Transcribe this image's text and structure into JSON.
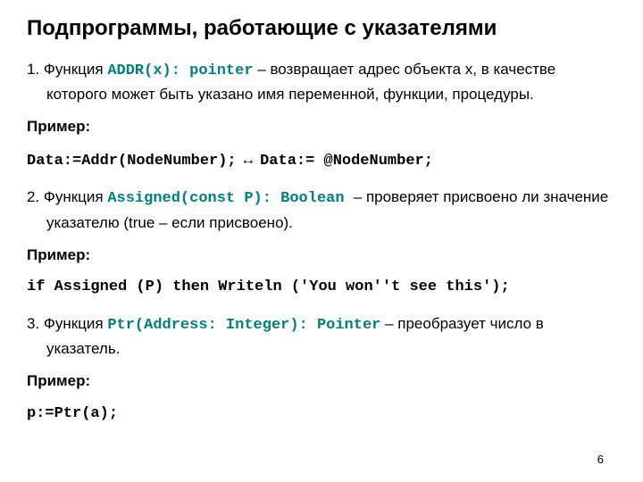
{
  "title": "Подпрограммы, работающие с указателями",
  "item1": {
    "lead": "1. Функция ",
    "code": "ADDR(x): pointer",
    "rest1": " – возвращает адрес объекта х, в качестве которого может быть указано имя переменной, функции, процедуры.",
    "exlabel": "Пример:",
    "exline_a": "Data:=Addr(NodeNumber);",
    "exline_arrow": " ↔ ",
    "exline_b": "Data:= @NodeNumber;"
  },
  "item2": {
    "lead": "2. Функция ",
    "code": "Assigned(const P): Boolean ",
    "rest1": " – проверяет присвоено ли значение указателю (true – если присвоено).",
    "exlabel": "Пример:",
    "exline": "if Assigned (P) then Writeln ('You won''t see this');"
  },
  "item3": {
    "lead": "3. Функция ",
    "code": "Ptr(Address: Integer): Pointer",
    "rest1": " – преобразует число в указатель.",
    "exlabel": "Пример:",
    "exline": "p:=Ptr(a);"
  },
  "page": "6"
}
